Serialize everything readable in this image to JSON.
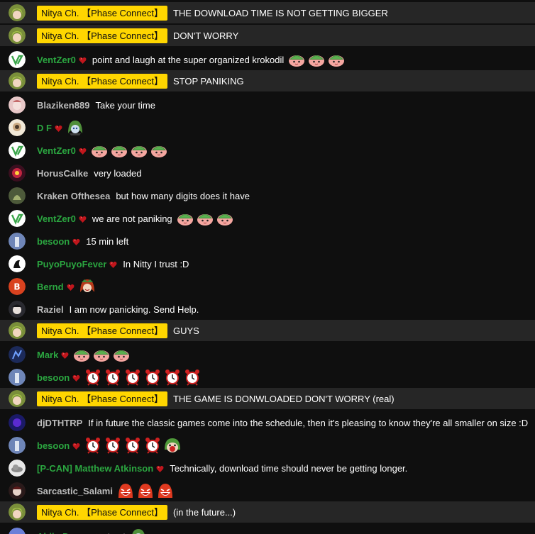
{
  "colors": {
    "background": "#0f0f0f",
    "owner_row": "#262626",
    "owner_badge": "#ffd600",
    "member_name": "#2ba640",
    "plain_name": "#bdbdbd"
  },
  "messages": [
    {
      "author": "Nitya Ch. 【Phase Connect】",
      "role": "owner",
      "avatar": "nitya",
      "text": "THE DOWNLOAD TIME IS NOT GETTING BIGGER",
      "emotes": []
    },
    {
      "author": "Nitya Ch. 【Phase Connect】",
      "role": "owner",
      "avatar": "nitya",
      "text": "DON'T WORRY",
      "emotes": []
    },
    {
      "author": "VentZer0",
      "role": "member",
      "avatar": "ventzer0",
      "text": "point and laugh at the super organized krokodil",
      "emotes": [
        "peach-face-emote",
        "peach-face-emote",
        "peach-face-emote"
      ]
    },
    {
      "author": "Nitya Ch. 【Phase Connect】",
      "role": "owner",
      "avatar": "nitya",
      "text": "STOP PANIKING",
      "emotes": []
    },
    {
      "author": "Blaziken889",
      "role": "plain",
      "avatar": "blaziken",
      "text": "Take your time",
      "emotes": []
    },
    {
      "author": "D F",
      "role": "member",
      "avatar": "df",
      "text": "",
      "emotes": [
        "green-hair-emote"
      ]
    },
    {
      "author": "VentZer0",
      "role": "member",
      "avatar": "ventzer0",
      "text": "",
      "emotes": [
        "peach-face-emote",
        "peach-face-emote",
        "peach-face-emote",
        "peach-face-emote"
      ]
    },
    {
      "author": "HorusCalke",
      "role": "plain",
      "avatar": "horus",
      "text": "very loaded",
      "emotes": []
    },
    {
      "author": "Kraken Ofthesea",
      "role": "plain",
      "avatar": "kraken",
      "text": "but how many digits does it have",
      "emotes": []
    },
    {
      "author": "VentZer0",
      "role": "member",
      "avatar": "ventzer0",
      "text": "we are not paniking",
      "emotes": [
        "peach-face-emote",
        "peach-face-emote",
        "peach-face-emote"
      ]
    },
    {
      "author": "besoon",
      "role": "member",
      "avatar": "besoon",
      "text": "15 min left",
      "emotes": []
    },
    {
      "author": "PuyoPuyoFever",
      "role": "member",
      "avatar": "puyo",
      "text": "In Nitty I trust :D",
      "emotes": []
    },
    {
      "author": "Bernd",
      "role": "member",
      "avatar": "bernd",
      "text": "",
      "emotes": [
        "red-hair-emote"
      ]
    },
    {
      "author": "Raziel",
      "role": "plain",
      "avatar": "raziel",
      "text": "I am now panicking. Send Help.",
      "emotes": []
    },
    {
      "author": "Nitya Ch. 【Phase Connect】",
      "role": "owner",
      "avatar": "nitya",
      "text": "GUYS",
      "emotes": []
    },
    {
      "author": "Mark",
      "role": "member",
      "avatar": "mark",
      "text": "",
      "emotes": [
        "peach-face-emote",
        "peach-face-emote",
        "peach-face-emote"
      ]
    },
    {
      "author": "besoon",
      "role": "member",
      "avatar": "besoon",
      "text": "",
      "emotes": [
        "alarm-clock-emote",
        "alarm-clock-emote",
        "alarm-clock-emote",
        "alarm-clock-emote",
        "alarm-clock-emote",
        "alarm-clock-emote"
      ]
    },
    {
      "author": "Nitya Ch. 【Phase Connect】",
      "role": "owner",
      "avatar": "nitya",
      "text": "THE GAME IS DONWLOADED DON'T WORRY (real)",
      "emotes": []
    },
    {
      "author": "djDTHTRP",
      "role": "plain",
      "avatar": "dj",
      "text": "If in future the classic games come into the schedule, then it's pleasing to know they're all smaller on size :D",
      "emotes": []
    },
    {
      "author": "besoon",
      "role": "member",
      "avatar": "besoon",
      "text": "",
      "emotes": [
        "alarm-clock-emote",
        "alarm-clock-emote",
        "alarm-clock-emote",
        "alarm-clock-emote",
        "screaming-emote"
      ]
    },
    {
      "author": "[P-CAN] Matthew Atkinson",
      "role": "member",
      "avatar": "cloud",
      "text": "Technically, download time should never be getting longer.",
      "emotes": []
    },
    {
      "author": "Sarcastic_Salami",
      "role": "plain",
      "avatar": "salami",
      "text": "",
      "emotes": [
        "red-laugh-emote",
        "red-laugh-emote",
        "red-laugh-emote"
      ]
    },
    {
      "author": "Nitya Ch. 【Phase Connect】",
      "role": "owner",
      "avatar": "nitya",
      "text": "(in the future...)",
      "emotes": []
    },
    {
      "author": "Abijo Dogan",
      "role": "member",
      "avatar": "abijo",
      "text": "trust",
      "emotes": [
        "green-hair-emote"
      ]
    }
  ]
}
